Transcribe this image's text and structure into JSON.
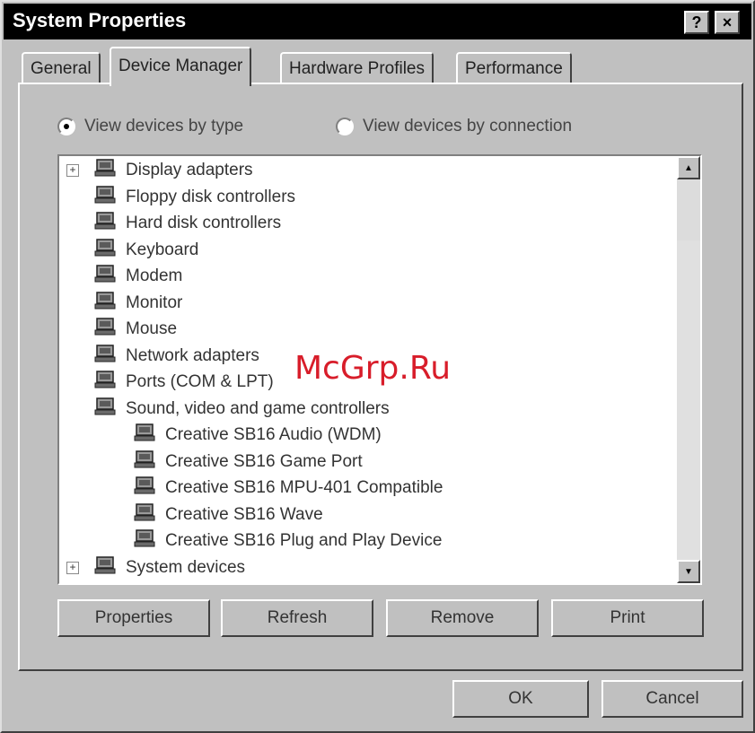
{
  "window": {
    "title": "System Properties"
  },
  "titlebar": {
    "help_glyph": "?",
    "close_glyph": "×"
  },
  "tabs": [
    {
      "label": "General"
    },
    {
      "label": "Device Manager"
    },
    {
      "label": "Hardware Profiles"
    },
    {
      "label": "Performance"
    }
  ],
  "view": {
    "by_type_label": "View devices by type",
    "by_connection_label": "View devices by connection",
    "selected": "by_type"
  },
  "tree": {
    "items": [
      {
        "label": "Display adapters",
        "icon": "display-adapter-icon",
        "level": 0,
        "expander": "+"
      },
      {
        "label": "Floppy disk controllers",
        "icon": "floppy-controller-icon",
        "level": 0
      },
      {
        "label": "Hard disk controllers",
        "icon": "hard-disk-controller-icon",
        "level": 0
      },
      {
        "label": "Keyboard",
        "icon": "keyboard-icon",
        "level": 0
      },
      {
        "label": "Modem",
        "icon": "modem-icon",
        "level": 0
      },
      {
        "label": "Monitor",
        "icon": "monitor-icon",
        "level": 0
      },
      {
        "label": "Mouse",
        "icon": "mouse-icon",
        "level": 0
      },
      {
        "label": "Network adapters",
        "icon": "network-adapter-icon",
        "level": 0
      },
      {
        "label": "Ports (COM & LPT)",
        "icon": "ports-icon",
        "level": 0
      },
      {
        "label": "Sound, video and game controllers",
        "icon": "sound-controller-icon",
        "level": 0
      },
      {
        "label": "Creative SB16 Audio (WDM)",
        "icon": "sound-device-icon",
        "level": 1
      },
      {
        "label": "Creative SB16 Game Port",
        "icon": "sound-device-icon",
        "level": 1
      },
      {
        "label": "Creative SB16 MPU-401 Compatible",
        "icon": "sound-device-icon",
        "level": 1
      },
      {
        "label": "Creative SB16 Wave",
        "icon": "sound-device-icon",
        "level": 1
      },
      {
        "label": "Creative SB16 Plug and Play Device",
        "icon": "sound-device-icon",
        "level": 1
      },
      {
        "label": "System devices",
        "icon": "system-devices-icon",
        "level": 0,
        "expander": "+"
      }
    ]
  },
  "buttons": {
    "properties": "Properties",
    "refresh": "Refresh",
    "remove": "Remove",
    "print": "Print",
    "ok": "OK",
    "cancel": "Cancel"
  },
  "scrollbar": {
    "up_glyph": "▲",
    "down_glyph": "▼"
  },
  "watermark": {
    "text": "McGrp.Ru"
  },
  "colors": {
    "titlebar_bg": "#000000",
    "face": "#c0c0c0",
    "watermark": "#d81d2a"
  }
}
